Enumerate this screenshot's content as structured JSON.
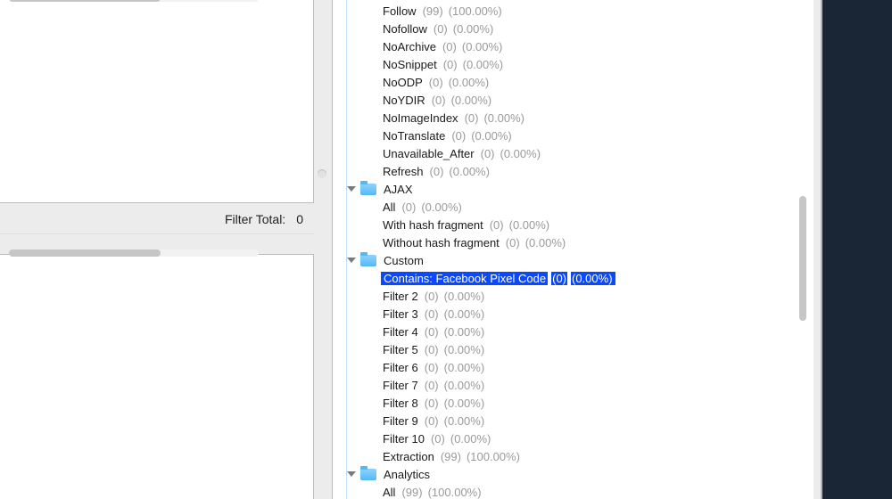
{
  "left": {
    "filter_total_label": "Filter Total:",
    "filter_total_value": "0"
  },
  "tree": {
    "flat": [
      {
        "kind": "leaf",
        "label": "Follow",
        "count": "(99)",
        "pct": "(100.00%)",
        "selected": false
      },
      {
        "kind": "leaf",
        "label": "Nofollow",
        "count": "(0)",
        "pct": "(0.00%)",
        "selected": false
      },
      {
        "kind": "leaf",
        "label": "NoArchive",
        "count": "(0)",
        "pct": "(0.00%)",
        "selected": false
      },
      {
        "kind": "leaf",
        "label": "NoSnippet",
        "count": "(0)",
        "pct": "(0.00%)",
        "selected": false
      },
      {
        "kind": "leaf",
        "label": "NoODP",
        "count": "(0)",
        "pct": "(0.00%)",
        "selected": false
      },
      {
        "kind": "leaf",
        "label": "NoYDIR",
        "count": "(0)",
        "pct": "(0.00%)",
        "selected": false
      },
      {
        "kind": "leaf",
        "label": "NoImageIndex",
        "count": "(0)",
        "pct": "(0.00%)",
        "selected": false
      },
      {
        "kind": "leaf",
        "label": "NoTranslate",
        "count": "(0)",
        "pct": "(0.00%)",
        "selected": false
      },
      {
        "kind": "leaf",
        "label": "Unavailable_After",
        "count": "(0)",
        "pct": "(0.00%)",
        "selected": false
      },
      {
        "kind": "leaf",
        "label": "Refresh",
        "count": "(0)",
        "pct": "(0.00%)",
        "selected": false
      },
      {
        "kind": "group",
        "label": "AJAX"
      },
      {
        "kind": "leaf",
        "label": "All",
        "count": "(0)",
        "pct": "(0.00%)",
        "selected": false
      },
      {
        "kind": "leaf",
        "label": "With hash fragment",
        "count": "(0)",
        "pct": "(0.00%)",
        "selected": false
      },
      {
        "kind": "leaf",
        "label": "Without hash fragment",
        "count": "(0)",
        "pct": "(0.00%)",
        "selected": false
      },
      {
        "kind": "group",
        "label": "Custom"
      },
      {
        "kind": "leaf",
        "label": "Contains: Facebook Pixel Code",
        "count": "(0)",
        "pct": "(0.00%)",
        "selected": true
      },
      {
        "kind": "leaf",
        "label": "Filter 2",
        "count": "(0)",
        "pct": "(0.00%)",
        "selected": false
      },
      {
        "kind": "leaf",
        "label": "Filter 3",
        "count": "(0)",
        "pct": "(0.00%)",
        "selected": false
      },
      {
        "kind": "leaf",
        "label": "Filter 4",
        "count": "(0)",
        "pct": "(0.00%)",
        "selected": false
      },
      {
        "kind": "leaf",
        "label": "Filter 5",
        "count": "(0)",
        "pct": "(0.00%)",
        "selected": false
      },
      {
        "kind": "leaf",
        "label": "Filter 6",
        "count": "(0)",
        "pct": "(0.00%)",
        "selected": false
      },
      {
        "kind": "leaf",
        "label": "Filter 7",
        "count": "(0)",
        "pct": "(0.00%)",
        "selected": false
      },
      {
        "kind": "leaf",
        "label": "Filter 8",
        "count": "(0)",
        "pct": "(0.00%)",
        "selected": false
      },
      {
        "kind": "leaf",
        "label": "Filter 9",
        "count": "(0)",
        "pct": "(0.00%)",
        "selected": false
      },
      {
        "kind": "leaf",
        "label": "Filter 10",
        "count": "(0)",
        "pct": "(0.00%)",
        "selected": false
      },
      {
        "kind": "leaf",
        "label": "Extraction",
        "count": "(99)",
        "pct": "(100.00%)",
        "selected": false
      },
      {
        "kind": "group",
        "label": "Analytics"
      },
      {
        "kind": "leaf",
        "label": "All",
        "count": "(99)",
        "pct": "(100.00%)",
        "selected": false
      }
    ]
  }
}
